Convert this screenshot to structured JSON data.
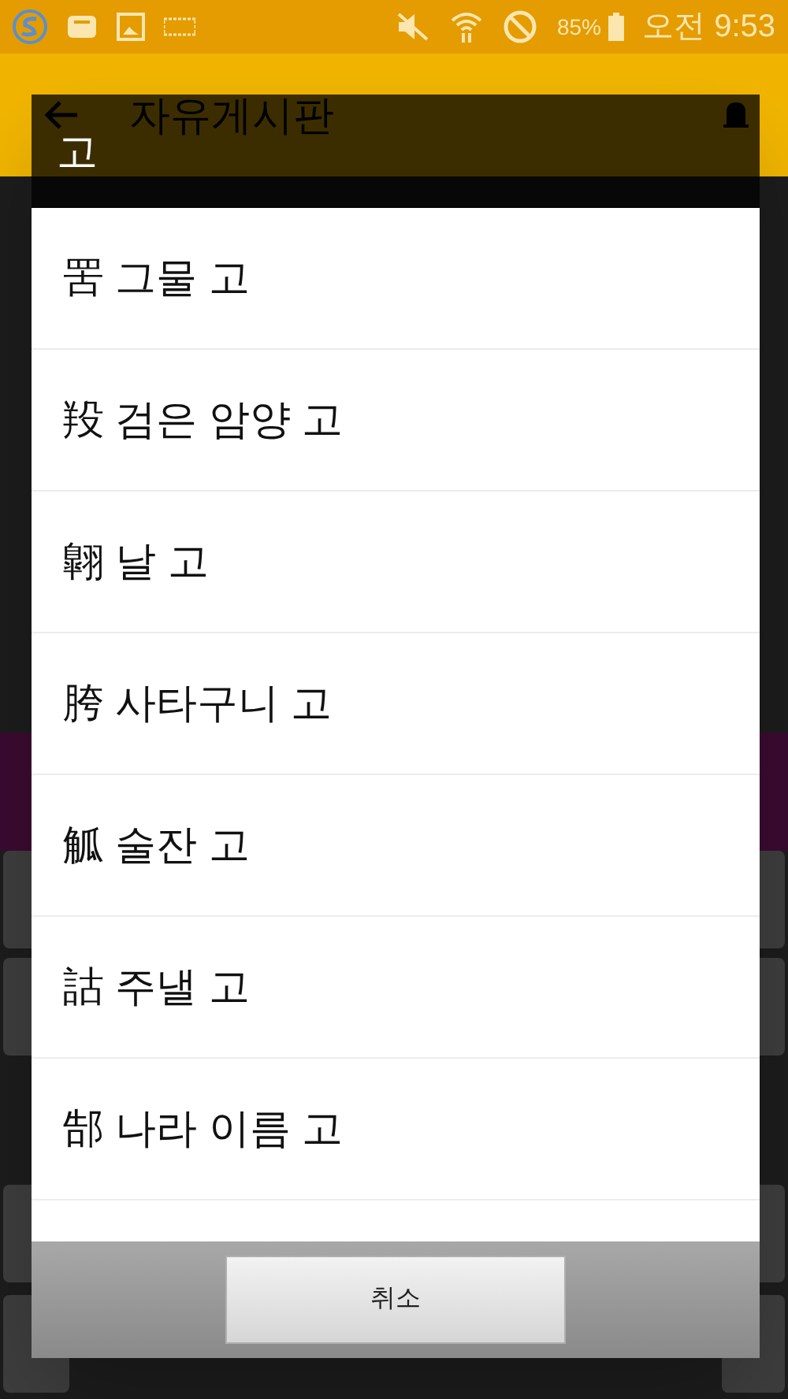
{
  "status_bar": {
    "battery": "85%",
    "time": "오전 9:53"
  },
  "app_bar": {
    "title": "자유게시판"
  },
  "dialog": {
    "title": "고",
    "items": [
      {
        "label": "罟 그물 고"
      },
      {
        "label": "羖 검은 암양 고"
      },
      {
        "label": "翺 날 고"
      },
      {
        "label": "胯 사타구니 고"
      },
      {
        "label": "觚 술잔 고"
      },
      {
        "label": "詁 주낼 고"
      },
      {
        "label": "郜 나라 이름 고"
      }
    ],
    "cancel_button": "취소"
  }
}
